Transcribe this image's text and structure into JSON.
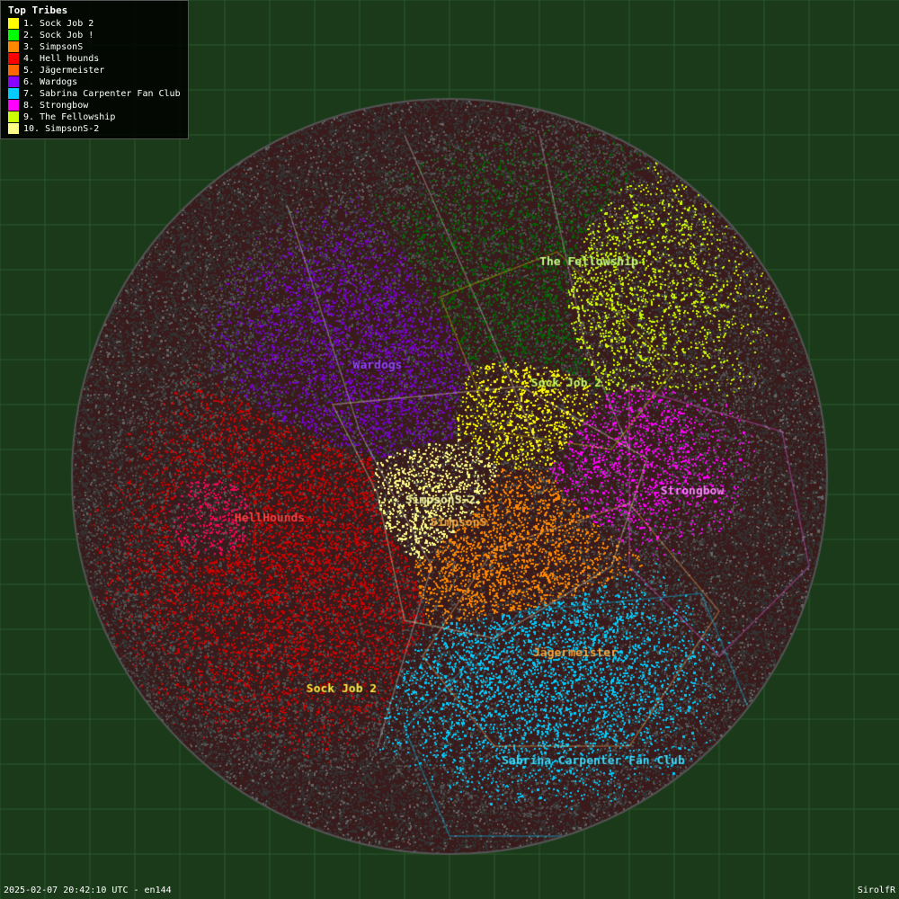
{
  "title": "Top Tribes",
  "legend": {
    "title": "Top Tribes",
    "items": [
      {
        "rank": "1",
        "label": "Sock Job 2",
        "color": "#ffff00"
      },
      {
        "rank": "2",
        "label": "Sock Job !",
        "color": "#00ff00"
      },
      {
        "rank": "3",
        "label": "SimpsonS",
        "color": "#ff8800"
      },
      {
        "rank": "4",
        "label": "Hell Hounds",
        "color": "#ff0000"
      },
      {
        "rank": "5",
        "label": "Jägermeister",
        "color": "#ff6600"
      },
      {
        "rank": "6",
        "label": "Wardogs",
        "color": "#8800ff"
      },
      {
        "rank": "7",
        "label": "Sabrina Carpenter Fan Club",
        "color": "#00ccff"
      },
      {
        "rank": "8",
        "label": "Strongbow",
        "color": "#ff00ff"
      },
      {
        "rank": "9",
        "label": "The Fellowship",
        "color": "#ccff00"
      },
      {
        "rank": "10",
        "label": "SimpsonS-2",
        "color": "#ffff88"
      }
    ]
  },
  "timestamp": "2025-02-07 20:42:10 UTC - en144",
  "attribution": "SirolfR",
  "map": {
    "centerX": 500,
    "centerY": 530,
    "radius": 420
  }
}
